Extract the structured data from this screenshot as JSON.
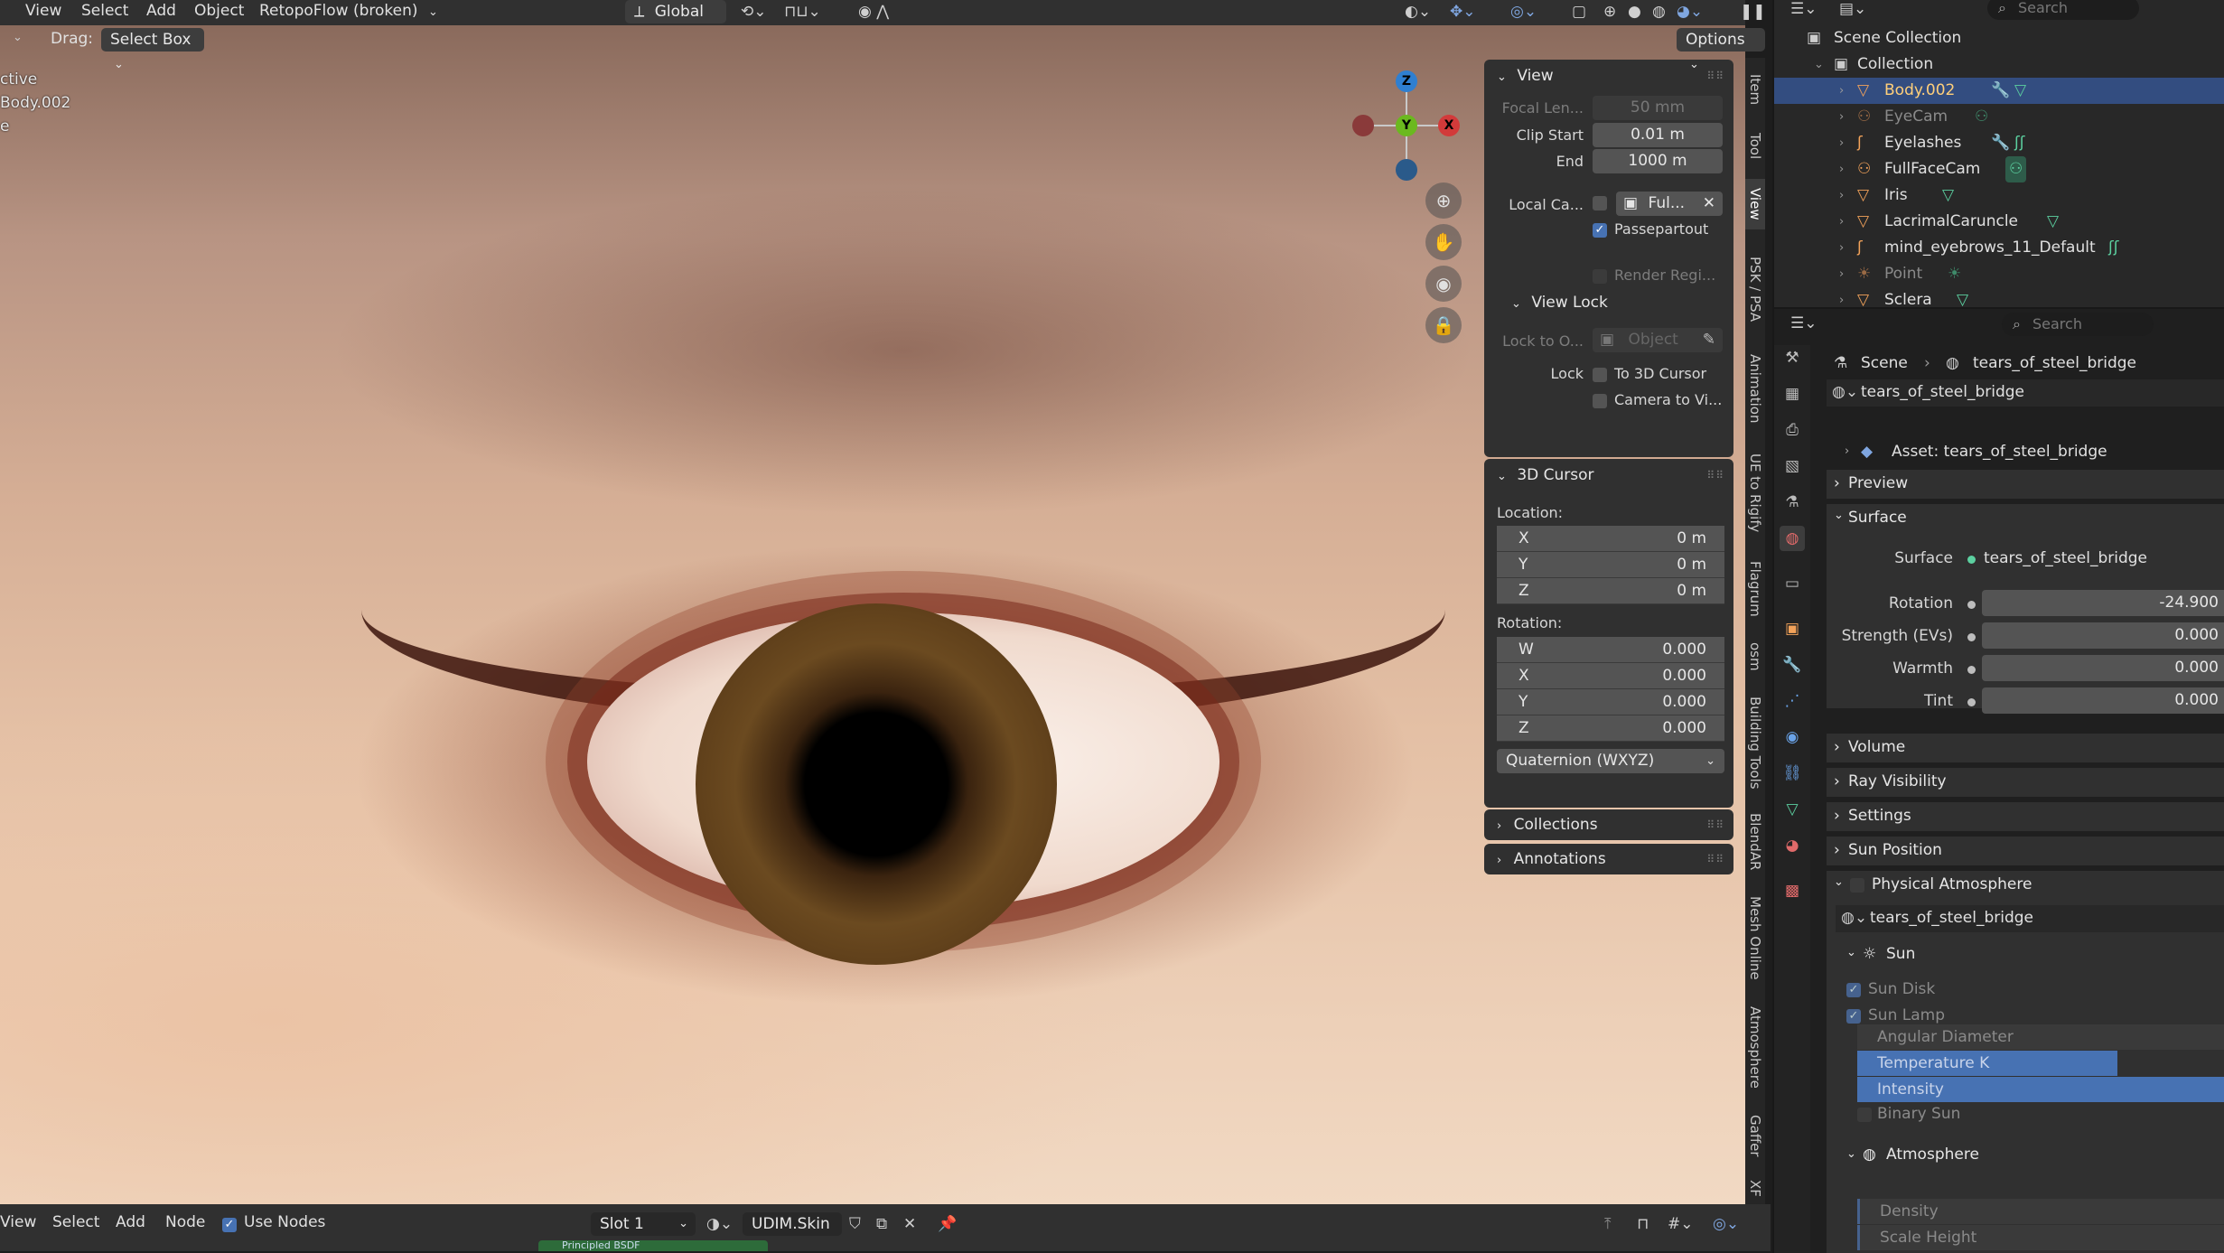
{
  "header": {
    "menus": [
      "View",
      "Select",
      "Add",
      "Object"
    ],
    "addon_menu": "RetopoFlow (broken)",
    "orientation": "Global"
  },
  "toolbar": {
    "drag_label": "Drag:",
    "drag_value": "Select Box",
    "options_label": "Options"
  },
  "viewport": {
    "overlay_lines": [
      "ctive",
      "Body.002",
      "e"
    ],
    "gizmo": {
      "z": "Z",
      "y": "Y",
      "x": "X"
    }
  },
  "npanel": {
    "view": {
      "title": "View",
      "focal_label": "Focal Len...",
      "focal_value": "50 mm",
      "clip_start_label": "Clip Start",
      "clip_start_value": "0.01 m",
      "clip_end_label": "End",
      "clip_end_value": "1000 m",
      "local_camera_label": "Local Ca...",
      "local_camera_value": "Ful...",
      "passepartout_label": "Passepartout",
      "render_region_label": "Render Regi...",
      "view_lock_title": "View Lock",
      "lock_to_object_label": "Lock to O...",
      "lock_to_object_placeholder": "Object",
      "lock_label": "Lock",
      "to_3d_cursor_label": "To 3D Cursor",
      "camera_to_view_label": "Camera to Vi..."
    },
    "cursor": {
      "title": "3D Cursor",
      "location_label": "Location:",
      "location": [
        {
          "k": "X",
          "v": "0 m"
        },
        {
          "k": "Y",
          "v": "0 m"
        },
        {
          "k": "Z",
          "v": "0 m"
        }
      ],
      "rotation_label": "Rotation:",
      "rotation": [
        {
          "k": "W",
          "v": "0.000"
        },
        {
          "k": "X",
          "v": "0.000"
        },
        {
          "k": "Y",
          "v": "0.000"
        },
        {
          "k": "Z",
          "v": "0.000"
        }
      ],
      "mode": "Quaternion (WXYZ)"
    },
    "collections_title": "Collections",
    "annotations_title": "Annotations",
    "tabs": [
      "Item",
      "Tool",
      "View",
      "PSK / PSA",
      "Animation",
      "UE to Rigify",
      "Flagrum",
      "osm",
      "Building Tools",
      "BlendAR",
      "Mesh Online",
      "Atmosphere",
      "Gaffer",
      "XF"
    ]
  },
  "footer": {
    "menus": [
      "View",
      "Select",
      "Add",
      "Node"
    ],
    "use_nodes_label": "Use Nodes",
    "slot": "Slot 1",
    "material": "UDIM.Skin",
    "node_label": "Principled BSDF"
  },
  "outliner": {
    "search_placeholder": "Search",
    "scene_collection": "Scene Collection",
    "collection": "Collection",
    "items": [
      {
        "name": "Body.002",
        "selected": true,
        "dim": false
      },
      {
        "name": "EyeCam",
        "selected": false,
        "dim": true
      },
      {
        "name": "Eyelashes",
        "selected": false,
        "dim": false
      },
      {
        "name": "FullFaceCam",
        "selected": false,
        "dim": false
      },
      {
        "name": "Iris",
        "selected": false,
        "dim": false
      },
      {
        "name": "LacrimalCaruncle",
        "selected": false,
        "dim": false
      },
      {
        "name": "mind_eyebrows_11_Default",
        "selected": false,
        "dim": false
      },
      {
        "name": "Point",
        "selected": false,
        "dim": true
      },
      {
        "name": "Sclera",
        "selected": false,
        "dim": false
      }
    ]
  },
  "properties": {
    "search_placeholder": "Search",
    "breadcrumb": [
      "Scene",
      "tears_of_steel_bridge"
    ],
    "world_name": "tears_of_steel_bridge",
    "asset_label": "Asset: tears_of_steel_bridge",
    "sections": {
      "preview": "Preview",
      "surface": "Surface",
      "volume": "Volume",
      "ray_visibility": "Ray Visibility",
      "settings": "Settings",
      "sun_position": "Sun Position",
      "physical_atmosphere": "Physical Atmosphere"
    },
    "surface": {
      "surface_label": "Surface",
      "surface_value": "tears_of_steel_bridge",
      "rotation_label": "Rotation",
      "rotation_value": "-24.900",
      "strength_label": "Strength (EVs)",
      "strength_value": "0.000",
      "warmth_label": "Warmth",
      "warmth_value": "0.000",
      "tint_label": "Tint",
      "tint_value": "0.000"
    },
    "atmosphere": {
      "world_name": "tears_of_steel_bridge",
      "sun_title": "Sun",
      "sun_disk_label": "Sun Disk",
      "sun_lamp_label": "Sun Lamp",
      "angular_diameter_label": "Angular Diameter",
      "temperature_label": "Temperature K",
      "intensity_label": "Intensity",
      "binary_sun_label": "Binary Sun",
      "atmosphere_title": "Atmosphere",
      "density_label": "Density",
      "scale_height_label": "Scale Height"
    }
  },
  "colors": {
    "accent": "#4772b3",
    "selection": "#334d80",
    "panel": "#303030",
    "field": "#545454"
  }
}
